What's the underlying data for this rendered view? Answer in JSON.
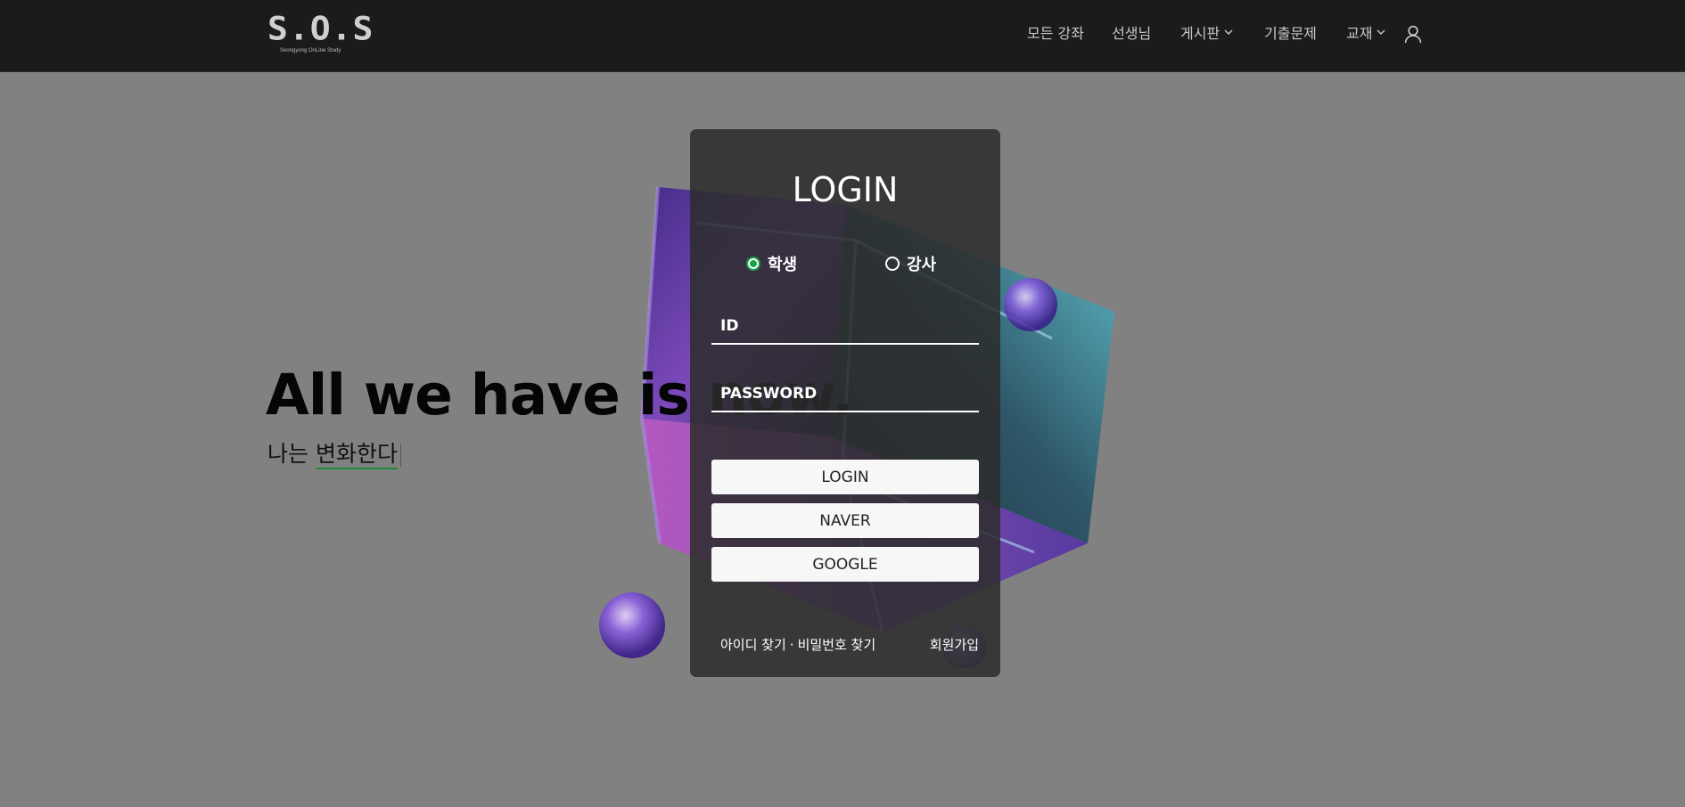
{
  "header": {
    "logo_text": "S.O.S",
    "logo_subtitle": "Seongyong OnLine Study",
    "nav": [
      {
        "label": "모든 강좌",
        "has_dropdown": false
      },
      {
        "label": "선생님",
        "has_dropdown": false
      },
      {
        "label": "게시판",
        "has_dropdown": true
      },
      {
        "label": "기출문제",
        "has_dropdown": false
      },
      {
        "label": "교재",
        "has_dropdown": true
      }
    ],
    "user_icon": "user-icon"
  },
  "hero": {
    "title": "All we have is now.",
    "subtitle_prefix": "나는 ",
    "subtitle_typed": "변화한다"
  },
  "login": {
    "title": "LOGIN",
    "roles": [
      {
        "label": "학생",
        "selected": true
      },
      {
        "label": "강사",
        "selected": false
      }
    ],
    "id_placeholder": "ID",
    "password_placeholder": "PASSWORD",
    "buttons": {
      "login": "LOGIN",
      "naver": "NAVER",
      "google": "GOOGLE"
    },
    "links": {
      "find_id": "아이디 찾기",
      "separator": "·",
      "find_password": "비밀번호 찾기",
      "signup": "회원가입"
    }
  },
  "colors": {
    "navbar_bg": "#1b1b1b",
    "page_bg": "#818181",
    "panel_bg": "#2c2c2c",
    "accent_green": "#1aa34a"
  }
}
